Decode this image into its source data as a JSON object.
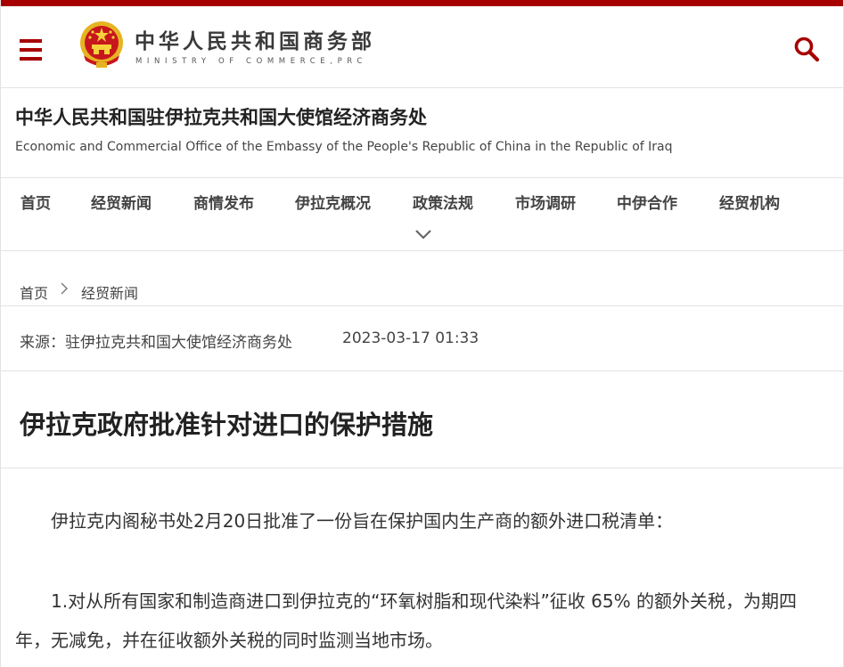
{
  "header": {
    "logo_cn": "中华人民共和国商务部",
    "logo_en": "MINISTRY OF COMMERCE,PRC",
    "menu_icon": "hamburger-menu-icon",
    "search_icon": "search-icon",
    "brand_color": "#a70000"
  },
  "office": {
    "name_cn": "中华人民共和国驻伊拉克共和国大使馆经济商务处",
    "name_en": "Economic and Commercial Office of the Embassy of the People's Republic of China in the Republic of Iraq"
  },
  "nav": {
    "items": [
      {
        "label": "首页"
      },
      {
        "label": "经贸新闻"
      },
      {
        "label": "商情发布"
      },
      {
        "label": "伊拉克概况"
      },
      {
        "label": "政策法规"
      },
      {
        "label": "市场调研"
      },
      {
        "label": "中伊合作"
      },
      {
        "label": "经贸机构"
      }
    ],
    "expand_icon": "chevron-down-icon"
  },
  "breadcrumb": {
    "home": "首页",
    "current": "经贸新闻",
    "separator_icon": "chevron-right-icon"
  },
  "article": {
    "source": "来源：驻伊拉克共和国大使馆经济商务处",
    "date": "2023-03-17 01:33",
    "title": "伊拉克政府批准针对进口的保护措施",
    "paragraphs": [
      "伊拉克内阁秘书处2月20日批准了一份旨在保护国内生产商的额外进口税清单：",
      "1.对从所有国家和制造商进口到伊拉克的“环氧树脂和现代染料”征收 65% 的额外关税，为期四年，无减免，并在征收额外关税的同时监测当地市场。"
    ]
  }
}
